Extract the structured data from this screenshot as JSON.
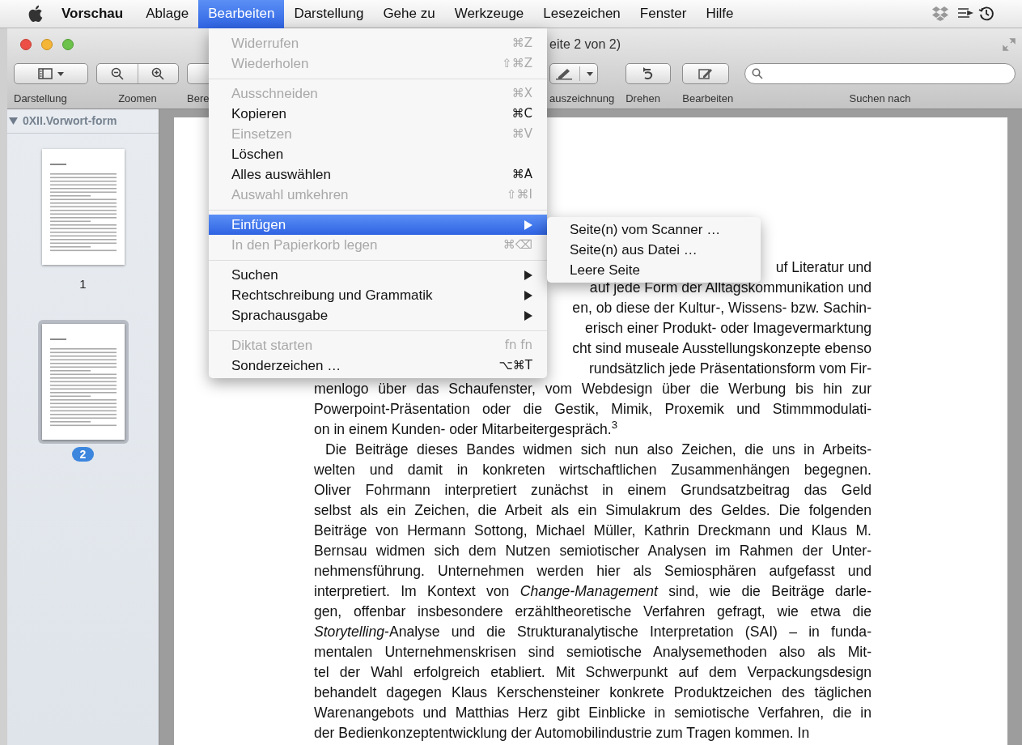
{
  "menubar": {
    "app": "Vorschau",
    "items": [
      {
        "label": "Ablage",
        "selected": false
      },
      {
        "label": "Bearbeiten",
        "selected": true
      },
      {
        "label": "Darstellung",
        "selected": false
      },
      {
        "label": "Gehe zu",
        "selected": false
      },
      {
        "label": "Werkzeuge",
        "selected": false
      },
      {
        "label": "Lesezeichen",
        "selected": false
      },
      {
        "label": "Fenster",
        "selected": false
      },
      {
        "label": "Hilfe",
        "selected": false
      }
    ]
  },
  "window": {
    "title": "eite 2 von 2)"
  },
  "toolbar": {
    "left": [
      {
        "kind": "view",
        "label": "Darstellung"
      },
      {
        "kind": "zoom",
        "label": "Zoomen"
      },
      {
        "kind": "partial",
        "label": "Bere"
      }
    ],
    "right": [
      {
        "kind": "markup",
        "label": "auszeichnung"
      },
      {
        "kind": "rotate",
        "label": "Drehen"
      },
      {
        "kind": "edit",
        "label": "Bearbeiten"
      }
    ],
    "search_label": "Suchen nach"
  },
  "sidebar": {
    "title": "0XII.Vorwort-form",
    "thumbnails": [
      {
        "label": "1",
        "selected": false
      },
      {
        "label": "2",
        "selected": true
      }
    ]
  },
  "document": {
    "partial_lines": [
      "uf Literatur und",
      "auf jede Form der Alltagskommunikation und",
      "en, ob diese der Kultur-, Wissens- bzw. Sachin-",
      "erisch einer Produkt- oder Imagevermarktung",
      "cht sind museale Ausstellungskonzepte ebenso",
      "rundsätzlich jede Präsentationsform vom Fir-"
    ],
    "paragraphs": [
      {
        "indent": false,
        "lines": [
          "menlogo über das Schaufenster, vom Webdesign über die Werbung bis hin zur",
          "Powerpoint-Präsentation oder die Gestik, Mimik, Proxemik und Stimmmodulati-",
          "on in einem Kunden- oder Mitarbeitergespräch.$^{3}$"
        ]
      },
      {
        "indent": true,
        "lines": [
          "Die Beiträge dieses Bandes widmen sich nun also Zeichen, die uns in Arbeits-",
          "welten und damit in konkreten wirtschaftlichen Zusammenhängen begegnen.",
          "Oliver Fohrmann interpretiert zunächst in einem Grundsatzbeitrag das Geld",
          "selbst als ein Zeichen, die Arbeit als ein Simulakrum des Geldes. Die folgenden",
          "Beiträge von Hermann Sottong, Michael Müller, Kathrin Dreckmann und Klaus M.",
          "Bernsau widmen sich dem Nutzen semiotischer Analysen im Rahmen der Unter-",
          "nehmensführung. Unternehmen werden hier als Semiosphären aufgefasst und",
          "interpretiert. Im Kontext von *Change-Management* sind, wie die Beiträge darle-",
          "gen, offenbar insbesondere erzähltheoretische Verfahren gefragt, wie etwa die",
          "*Storytelling*-Analyse und die Strukturanalytische Interpretation (SAI) – in funda-",
          "mentalen Unternehmenskrisen sind semiotische Analysemethoden also als Mit-",
          "tel der Wahl erfolgreich etabliert. Mit Schwerpunkt auf dem Verpackungsdesign",
          "behandelt dagegen Klaus Kerschensteiner konkrete Produktzeichen des täglichen",
          "Warenangebots und Matthias Herz gibt Einblicke in semiotische Verfahren, die in",
          "der Bedienkonzeptentwicklung der Automobilindustrie zum Tragen kommen. In"
        ]
      }
    ]
  },
  "edit_menu": [
    {
      "kind": "item",
      "label": "Widerrufen",
      "shortcut": "⌘Z",
      "disabled": true,
      "submenu": false,
      "selected": false
    },
    {
      "kind": "item",
      "label": "Wiederholen",
      "shortcut": "⇧⌘Z",
      "disabled": true,
      "submenu": false,
      "selected": false
    },
    {
      "kind": "separator"
    },
    {
      "kind": "item",
      "label": "Ausschneiden",
      "shortcut": "⌘X",
      "disabled": true,
      "submenu": false,
      "selected": false
    },
    {
      "kind": "item",
      "label": "Kopieren",
      "shortcut": "⌘C",
      "disabled": false,
      "submenu": false,
      "selected": false
    },
    {
      "kind": "item",
      "label": "Einsetzen",
      "shortcut": "⌘V",
      "disabled": true,
      "submenu": false,
      "selected": false
    },
    {
      "kind": "item",
      "label": "Löschen",
      "disabled": false,
      "submenu": false,
      "selected": false
    },
    {
      "kind": "item",
      "label": "Alles auswählen",
      "shortcut": "⌘A",
      "disabled": false,
      "submenu": false,
      "selected": false
    },
    {
      "kind": "item",
      "label": "Auswahl umkehren",
      "shortcut": "⇧⌘I",
      "disabled": true,
      "submenu": false,
      "selected": false
    },
    {
      "kind": "separator"
    },
    {
      "kind": "item",
      "label": "Einfügen",
      "disabled": false,
      "submenu": true,
      "selected": true
    },
    {
      "kind": "item",
      "label": "In den Papierkorb legen",
      "shortcut": "⌘⌫",
      "disabled": true,
      "submenu": false,
      "selected": false
    },
    {
      "kind": "separator"
    },
    {
      "kind": "item",
      "label": "Suchen",
      "disabled": false,
      "submenu": true,
      "selected": false
    },
    {
      "kind": "item",
      "label": "Rechtschreibung und Grammatik",
      "disabled": false,
      "submenu": true,
      "selected": false
    },
    {
      "kind": "item",
      "label": "Sprachausgabe",
      "disabled": false,
      "submenu": true,
      "selected": false
    },
    {
      "kind": "separator"
    },
    {
      "kind": "item",
      "label": "Diktat starten",
      "shortcut": "fn fn",
      "disabled": true,
      "submenu": false,
      "selected": false
    },
    {
      "kind": "item",
      "label": "Sonderzeichen …",
      "shortcut": "⌥⌘T",
      "disabled": false,
      "submenu": false,
      "selected": false
    }
  ],
  "submenu": [
    "Seite(n) vom Scanner …",
    "Seite(n) aus Datei …",
    "Leere Seite"
  ]
}
